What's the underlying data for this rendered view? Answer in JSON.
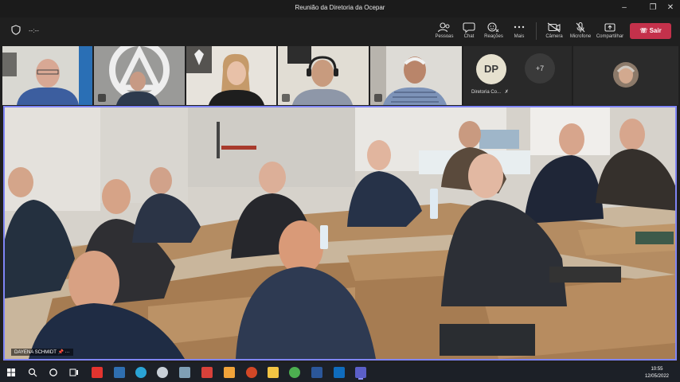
{
  "window": {
    "title": "Reunião da Diretoria da Ocepar",
    "controls": [
      "minimize-icon",
      "maximize-icon",
      "close-icon"
    ]
  },
  "toolbar": {
    "timer": "--:--",
    "buttons": [
      {
        "label": "Pessoas",
        "icon": "people-icon"
      },
      {
        "label": "Chat",
        "icon": "chat-icon"
      },
      {
        "label": "Reações",
        "icon": "reactions-icon"
      },
      {
        "label": "Mais",
        "icon": "more-icon"
      },
      {
        "label": "Câmera",
        "icon": "camera-off-icon"
      },
      {
        "label": "Microfone",
        "icon": "mic-off-icon"
      },
      {
        "label": "Compartilhar",
        "icon": "share-icon"
      }
    ],
    "leave_label": "Sair",
    "leave_color": "#c4314b"
  },
  "strip": {
    "participant_initials": "DP",
    "participant_name": "Diretoria Co...",
    "overflow": "+7"
  },
  "main": {
    "speaker_name": "DAYENA SCHMIDT",
    "active_border_color": "#7f85f5"
  },
  "taskbar": {
    "time": "10:55",
    "date": "12/05/2022"
  }
}
